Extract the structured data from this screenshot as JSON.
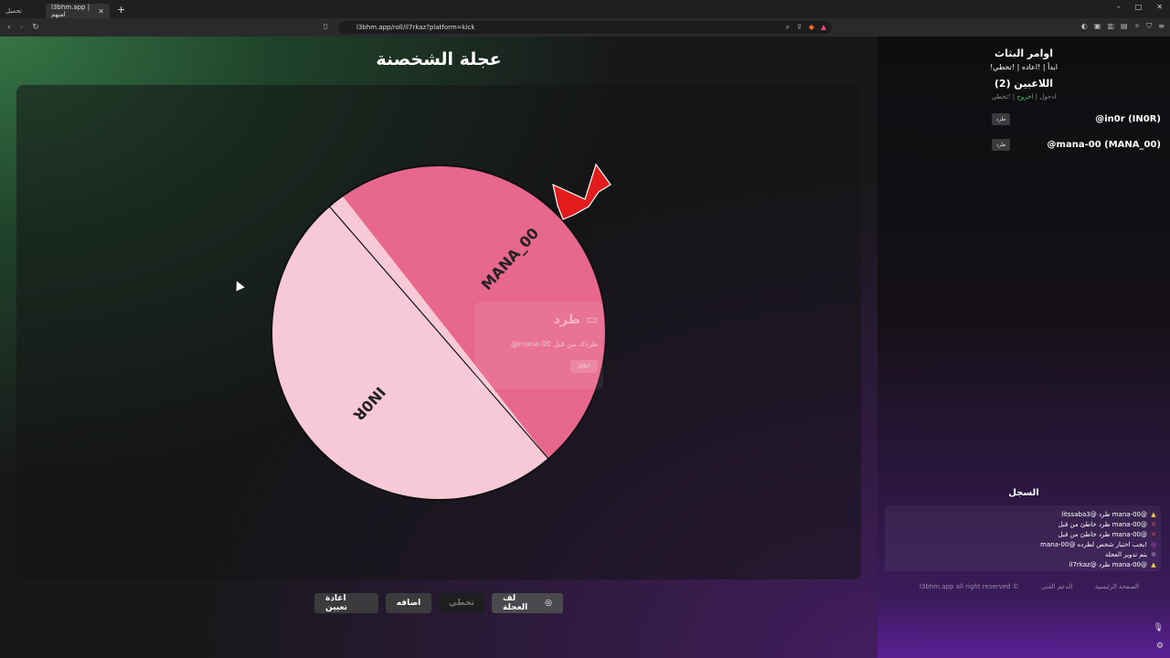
{
  "browser": {
    "tabs": [
      {
        "label": "تحمیل"
      },
      {
        "label": "l3bhm.app | لعبهم"
      }
    ],
    "new_tab": "+",
    "window_controls": [
      "–",
      "□",
      "✕"
    ],
    "url": "l3bhm.app/roll/il7rkaz?platform=kick"
  },
  "page": {
    "title": "عجلة الشخصنة"
  },
  "wheel": {
    "segments": [
      {
        "label": "MANA_00",
        "color": "#e8678f",
        "weight": 1
      },
      {
        "label": "IN0R",
        "color": "#f7c9d6",
        "weight": 1
      }
    ]
  },
  "kick_popup": {
    "title": "طرد",
    "message": "@mana-00 طردك من قبل",
    "close_label": "اغلاق"
  },
  "controls": {
    "reset_label": "اعادة تعيين",
    "add_label": "اضافه",
    "skip_label": "تخطي",
    "spin_label": "لف العجلة"
  },
  "sidebar": {
    "title": "اوامر البثاث",
    "commands": "!ابدأ | !اعاده | !تخطي",
    "players_title": "اللاعبين (2)",
    "actions": {
      "enter": "ادخول",
      "exit": "اخروج",
      "skip": "!تخطي"
    },
    "players": [
      {
        "name": "@in0r (IN0R)",
        "kick_label": "طرد"
      },
      {
        "name": "@mana-00 (MANA_00)",
        "kick_label": "طرد"
      }
    ],
    "log_title": "السجل",
    "log": [
      {
        "icon": "warn",
        "text": "litssaba3@ طرد mana-00@"
      },
      {
        "icon": "cross",
        "text": "طرد خاطئ من قبل mana-00@"
      },
      {
        "icon": "cross",
        "text": "طرد خاطئ من قبل mana-00@"
      },
      {
        "icon": "target",
        "text": "mana-00@ يجب اختيار شخص لطرده!"
      },
      {
        "icon": "gear",
        "text": "يتم تدوير العجلة"
      },
      {
        "icon": "warn",
        "text": "il7rkaz@ طرد mana-00@"
      }
    ],
    "footer": {
      "rights": "l3bhm.app all right reserved ©",
      "support": "الدعم الفني",
      "home": "الصفحة الرئيسية"
    }
  },
  "colors": {
    "segment_pink": "#e8678f",
    "segment_light": "#f7c9d6",
    "accent_green": "#3fc36f",
    "bolt_red": "#e21b1b"
  }
}
